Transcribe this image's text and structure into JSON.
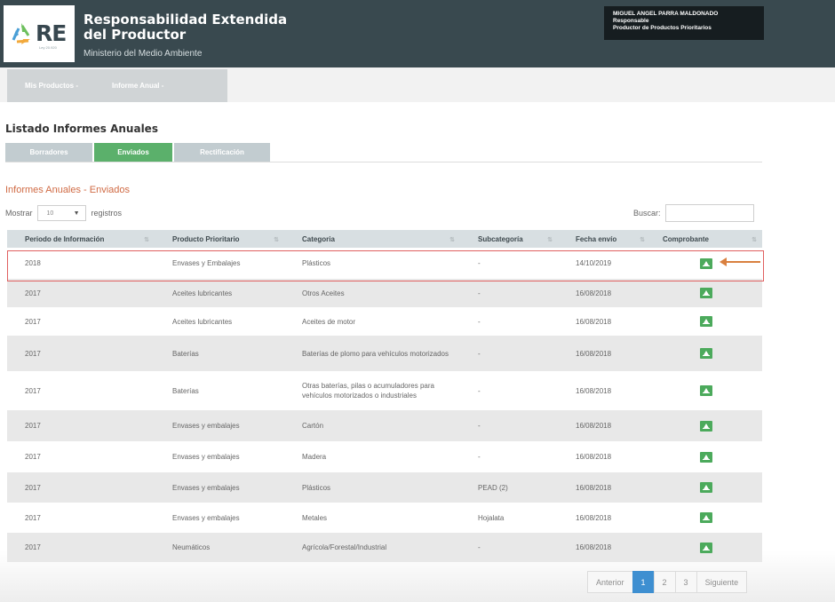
{
  "header": {
    "logo_text": "RE",
    "logo_sub": "Ley 20.920",
    "title": "Responsabilidad Extendida del Productor",
    "subtitle": "Ministerio del Medio Ambiente",
    "user": {
      "name": "MIGUEL ANGEL PARRA MALDONADO",
      "role": "Responsable",
      "profile": "Productor de Productos Prioritarios"
    }
  },
  "nav": {
    "items": [
      {
        "label": "Mis Productos -"
      },
      {
        "label": "Informe Anual -"
      }
    ]
  },
  "content": {
    "title": "Listado Informes Anuales",
    "tabs": [
      {
        "label": "Borradores"
      },
      {
        "label": "Enviados"
      },
      {
        "label": "Rectificación"
      }
    ],
    "section_title": "Informes Anuales - Enviados",
    "show_label": "Mostrar",
    "length_value": "10",
    "records_label": "registros",
    "search_label": "Buscar:",
    "search_value": ""
  },
  "table": {
    "columns": [
      "Periodo de Información",
      "Producto Prioritario",
      "Categoria",
      "Subcategoría",
      "Fecha envío",
      "Comprobante"
    ],
    "rows": [
      {
        "periodo": "2018",
        "producto": "Envases y Embalajes",
        "categoria": "Plásticos",
        "subcategoria": "-",
        "fecha": "14/10/2019"
      },
      {
        "periodo": "2017",
        "producto": "Aceites lubricantes",
        "categoria": "Otros Aceites",
        "subcategoria": "-",
        "fecha": "16/08/2018"
      },
      {
        "periodo": "2017",
        "producto": "Aceites lubricantes",
        "categoria": "Aceites de motor",
        "subcategoria": "-",
        "fecha": "16/08/2018"
      },
      {
        "periodo": "2017",
        "producto": "Baterías",
        "categoria": "Baterías de plomo para vehículos motorizados",
        "subcategoria": "-",
        "fecha": "16/08/2018"
      },
      {
        "periodo": "2017",
        "producto": "Baterías",
        "categoria": "Otras baterías, pilas o acumuladores para vehículos motorizados o industriales",
        "subcategoria": "-",
        "fecha": "16/08/2018"
      },
      {
        "periodo": "2017",
        "producto": "Envases y embalajes",
        "categoria": "Cartón",
        "subcategoria": "-",
        "fecha": "16/08/2018"
      },
      {
        "periodo": "2017",
        "producto": "Envases y embalajes",
        "categoria": "Madera",
        "subcategoria": "-",
        "fecha": "16/08/2018"
      },
      {
        "periodo": "2017",
        "producto": "Envases y embalajes",
        "categoria": "Plásticos",
        "subcategoria": "PEAD (2)",
        "fecha": "16/08/2018"
      },
      {
        "periodo": "2017",
        "producto": "Envases y embalajes",
        "categoria": "Metales",
        "subcategoria": "Hojalata",
        "fecha": "16/08/2018"
      },
      {
        "periodo": "2017",
        "producto": "Neumáticos",
        "categoria": "Agrícola/Forestal/Industrial",
        "subcategoria": "-",
        "fecha": "16/08/2018"
      }
    ]
  },
  "pagination": {
    "prev": "Anterior",
    "pages": [
      "1",
      "2",
      "3"
    ],
    "next": "Siguiente"
  },
  "colors": {
    "header_bg": "#39494f",
    "tab_active": "#5bb06b",
    "section_title": "#d06b45",
    "download_icon": "#4caa5c",
    "page_active": "#3e8fd1",
    "highlight_border": "#e06060",
    "arrow": "#d9803f"
  },
  "icons": {
    "download": "download-icon",
    "sort": "sort-icon",
    "dropdown": "chevron-down-icon",
    "logo": "recycle-icon"
  }
}
